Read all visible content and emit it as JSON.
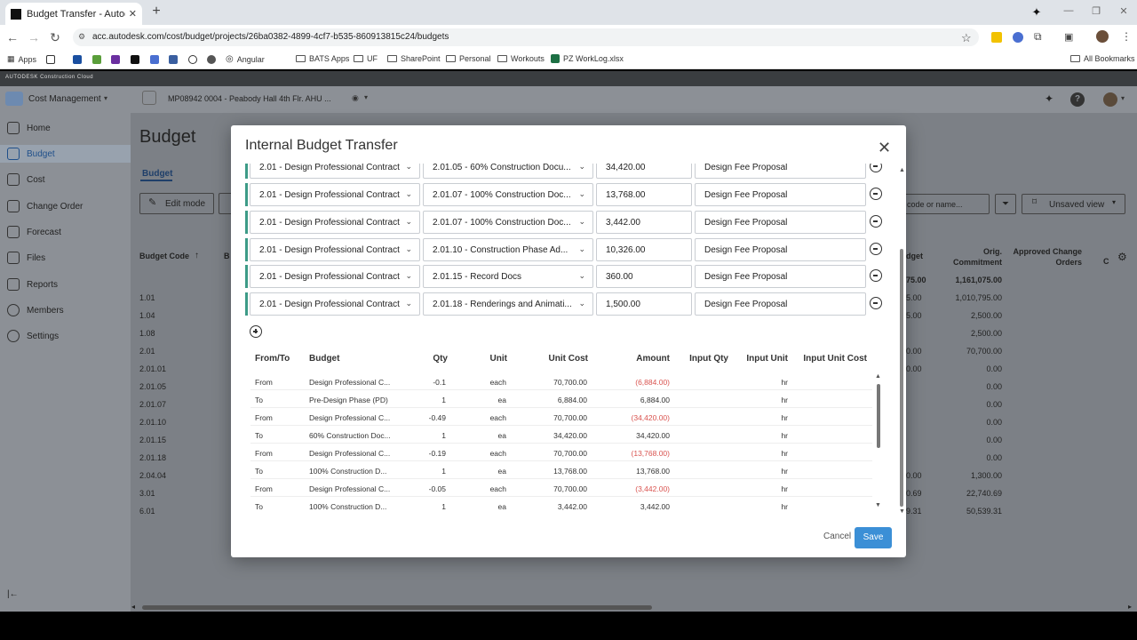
{
  "browser": {
    "tab_title": "Budget Transfer - Autodesk Co",
    "url": "acc.autodesk.com/cost/budget/projects/26ba0382-4899-4cf7-b535-860913815c24/budgets",
    "bookmarks": [
      "Apps",
      "Angular",
      "BATS Apps",
      "UF",
      "SharePoint",
      "Personal",
      "Workouts",
      "PZ WorkLog.xlsx"
    ],
    "all_bookmarks": "All Bookmarks"
  },
  "app": {
    "brand": "AUTODESK Construction Cloud",
    "module": "Cost Management",
    "project": "MP08942 0004 - Peabody Hall 4th Flr. AHU ...",
    "page_title": "Budget",
    "sub_tab": "Budget",
    "edit_mode": "Edit mode",
    "search_placeholder": "code or name...",
    "view": "Unsaved view"
  },
  "sidebar": {
    "items": [
      "Home",
      "Budget",
      "Cost",
      "Change Order",
      "Forecast",
      "Files",
      "Reports",
      "Members",
      "Settings"
    ]
  },
  "background_table": {
    "col_budget_code": "Budget Code",
    "col_b": "B",
    "col_budget": "dget",
    "col_orig_commitment": "Orig. Commitment",
    "col_approved_change": "Approved Change Orders",
    "col_c": "C",
    "codes": [
      "1.01",
      "1.04",
      "1.08",
      "2.01",
      "2.01.01",
      "2.01.05",
      "2.01.07",
      "2.01.10",
      "2.01.15",
      "2.01.18",
      "2.04.04",
      "3.01",
      "6.01"
    ],
    "budget_partial": [
      "75.00",
      "5.00",
      "5.00",
      "0.00",
      "0.00",
      "",
      "",
      "",
      "",
      "",
      "0.00",
      "0.69",
      "9.31"
    ],
    "orig_commitment": [
      "1,161,075.00",
      "1,010,795.00",
      "2,500.00",
      "2,500.00",
      "70,700.00",
      "0.00",
      "0.00",
      "0.00",
      "0.00",
      "0.00",
      "0.00",
      "1,300.00",
      "22,740.69",
      "50,539.31"
    ]
  },
  "modal": {
    "title": "Internal Budget Transfer",
    "rows": [
      {
        "from": "2.01 - Design Professional Contract",
        "to": "2.01.05 - 60% Construction Docu...",
        "amount": "34,420.00",
        "note": "Design Fee Proposal"
      },
      {
        "from": "2.01 - Design Professional Contract",
        "to": "2.01.07 - 100% Construction Doc...",
        "amount": "13,768.00",
        "note": "Design Fee Proposal"
      },
      {
        "from": "2.01 - Design Professional Contract",
        "to": "2.01.07 - 100% Construction Doc...",
        "amount": "3,442.00",
        "note": "Design Fee Proposal"
      },
      {
        "from": "2.01 - Design Professional Contract",
        "to": "2.01.10 - Construction Phase Ad...",
        "amount": "10,326.00",
        "note": "Design Fee Proposal"
      },
      {
        "from": "2.01 - Design Professional Contract",
        "to": "2.01.15 - Record Docs",
        "amount": "360.00",
        "note": "Design Fee Proposal"
      },
      {
        "from": "2.01 - Design Professional Contract",
        "to": "2.01.18 - Renderings and Animati...",
        "amount": "1,500.00",
        "note": "Design Fee Proposal"
      }
    ],
    "table_headers": {
      "from_to": "From/To",
      "budget": "Budget",
      "qty": "Qty",
      "unit": "Unit",
      "unit_cost": "Unit Cost",
      "amount": "Amount",
      "input_qty": "Input Qty",
      "input_unit": "Input Unit",
      "input_unit_cost": "Input Unit Cost"
    },
    "table_rows": [
      {
        "dir": "From",
        "budget": "Design Professional C...",
        "qty": "-0.1",
        "unit": "each",
        "unit_cost": "70,700.00",
        "amount": "(6,884.00)",
        "input_unit": "hr"
      },
      {
        "dir": "To",
        "budget": "Pre-Design Phase (PD)",
        "qty": "1",
        "unit": "ea",
        "unit_cost": "6,884.00",
        "amount": "6,884.00",
        "input_unit": "hr"
      },
      {
        "dir": "From",
        "budget": "Design Professional C...",
        "qty": "-0.49",
        "unit": "each",
        "unit_cost": "70,700.00",
        "amount": "(34,420.00)",
        "input_unit": "hr"
      },
      {
        "dir": "To",
        "budget": "60% Construction Doc...",
        "qty": "1",
        "unit": "ea",
        "unit_cost": "34,420.00",
        "amount": "34,420.00",
        "input_unit": "hr"
      },
      {
        "dir": "From",
        "budget": "Design Professional C...",
        "qty": "-0.19",
        "unit": "each",
        "unit_cost": "70,700.00",
        "amount": "(13,768.00)",
        "input_unit": "hr"
      },
      {
        "dir": "To",
        "budget": "100% Construction D...",
        "qty": "1",
        "unit": "ea",
        "unit_cost": "13,768.00",
        "amount": "13,768.00",
        "input_unit": "hr"
      },
      {
        "dir": "From",
        "budget": "Design Professional C...",
        "qty": "-0.05",
        "unit": "each",
        "unit_cost": "70,700.00",
        "amount": "(3,442.00)",
        "input_unit": "hr"
      },
      {
        "dir": "To",
        "budget": "100% Construction D...",
        "qty": "1",
        "unit": "ea",
        "unit_cost": "3,442.00",
        "amount": "3,442.00",
        "input_unit": "hr"
      }
    ],
    "cancel": "Cancel",
    "save": "Save"
  }
}
